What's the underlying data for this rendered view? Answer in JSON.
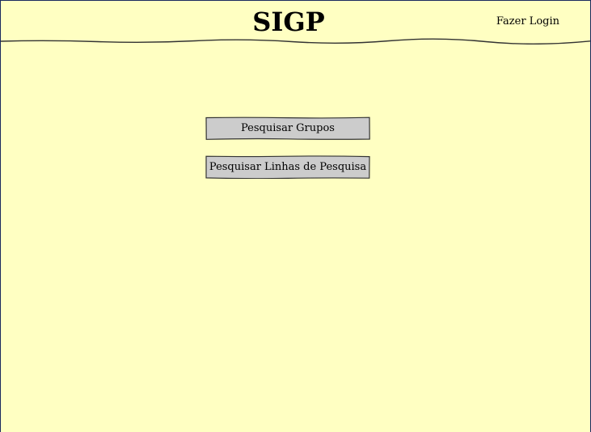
{
  "header": {
    "title": "SIGP",
    "login_label": "Fazer Login"
  },
  "main": {
    "buttons": [
      {
        "label": "Pesquisar Grupos"
      },
      {
        "label": "Pesquisar Linhas de Pesquisa"
      }
    ]
  },
  "colors": {
    "background": "#ffffc2",
    "button_fill": "#cccccc",
    "border": "#1a2a5e"
  }
}
